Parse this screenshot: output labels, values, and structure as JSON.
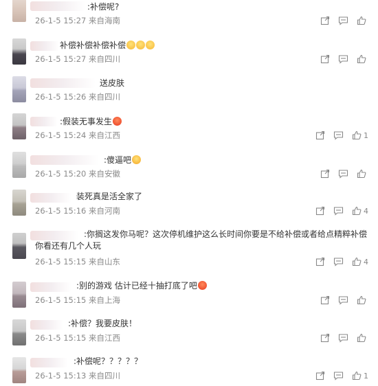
{
  "comments": [
    {
      "text": ":补偿呢?",
      "emojis": [],
      "meta": "26-1-5 15:27 来自海南",
      "likes": ""
    },
    {
      "text": "补偿补偿补偿补偿",
      "emojis": [
        "cry-emoji",
        "cry-emoji",
        "cry-emoji"
      ],
      "meta": "26-1-5 15:27 来自四川",
      "likes": ""
    },
    {
      "text": "送皮肤",
      "emojis": [],
      "meta": "26-1-5 15:26 来自四川",
      "likes": ""
    },
    {
      "text": ":假装无事发生",
      "emojis": [
        "tongue-emoji"
      ],
      "meta": "26-1-5 15:24 来自江西",
      "likes": "1"
    },
    {
      "text": ":傻逼吧",
      "emojis": [
        "laugh-emoji"
      ],
      "meta": "26-1-5 15:20 来自安徽",
      "likes": ""
    },
    {
      "text": "装死真是活全家了",
      "emojis": [],
      "meta": "26-1-5 15:16 来自河南",
      "likes": "4"
    },
    {
      "text": ":你搁这发你马呢？这次停机维护这么长时间你要是不给补偿或者给点精粹补偿你看还有几个人玩",
      "emojis": [],
      "meta": "26-1-5 15:15 来自山东",
      "likes": "4"
    },
    {
      "text": ":别的游戏 估计已经十抽打底了吧",
      "emojis": [
        "angry-emoji"
      ],
      "meta": "26-1-5 15:15 来自上海",
      "likes": ""
    },
    {
      "text": ":补偿？我要皮肤！",
      "emojis": [],
      "meta": "26-1-5 15:15 来自江西",
      "likes": ""
    },
    {
      "text": ":补偿呢？？？？？",
      "emojis": [],
      "meta": "26-1-5 15:13 来自四川",
      "likes": "1"
    }
  ],
  "icons": {
    "share": "share-icon",
    "comment": "comment-icon",
    "like": "like-icon"
  },
  "colors": {
    "meta": "#8a8a8a",
    "text": "#333333",
    "icon": "#888888"
  }
}
